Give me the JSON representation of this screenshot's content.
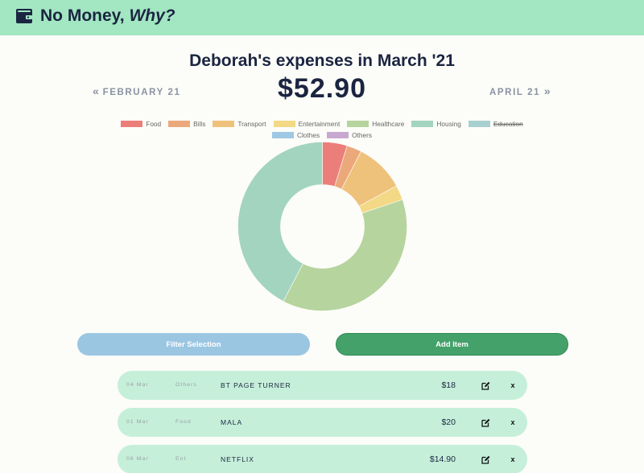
{
  "app": {
    "title_main": "No Money,",
    "title_em": "Why?"
  },
  "summary": {
    "heading": "Deborah's expenses in March '21",
    "total": "$52.90",
    "prev_month": "FEBRUARY 21",
    "next_month": "APRIL 21"
  },
  "chart_data": {
    "type": "pie",
    "variant": "donut",
    "legend_position": "top",
    "labels": [
      "Food",
      "Bills",
      "Transport",
      "Entertainment",
      "Healthcare",
      "Housing",
      "Education",
      "Clothes",
      "Others"
    ],
    "colors": [
      "#ec7e7a",
      "#eba97b",
      "#efc27b",
      "#f3d885",
      "#b6d49e",
      "#a3d4c0",
      "#a8d0cf",
      "#9ec8e3",
      "#c8a8d0"
    ],
    "hidden": [
      false,
      false,
      false,
      false,
      false,
      false,
      true,
      false,
      false
    ],
    "values": [
      2.5,
      1.5,
      5.0,
      1.5,
      20.0,
      22.4,
      0,
      0,
      0
    ]
  },
  "actions": {
    "filter_label": "Filter Selection",
    "add_label": "Add Item"
  },
  "expenses": [
    {
      "date": "04 Mar",
      "category": "Others",
      "description": "BT PAGE TURNER",
      "amount": "$18"
    },
    {
      "date": "01 Mar",
      "category": "Food",
      "description": "MALA",
      "amount": "$20"
    },
    {
      "date": "06 Mar",
      "category": "Ent",
      "description": "NETFLIX",
      "amount": "$14.90"
    }
  ],
  "row_actions": {
    "delete_label": "x"
  },
  "icons": {
    "brand": "wallet-icon",
    "edit": "edit-icon",
    "prev": "double-chevron-left-icon",
    "next": "double-chevron-right-icon"
  }
}
